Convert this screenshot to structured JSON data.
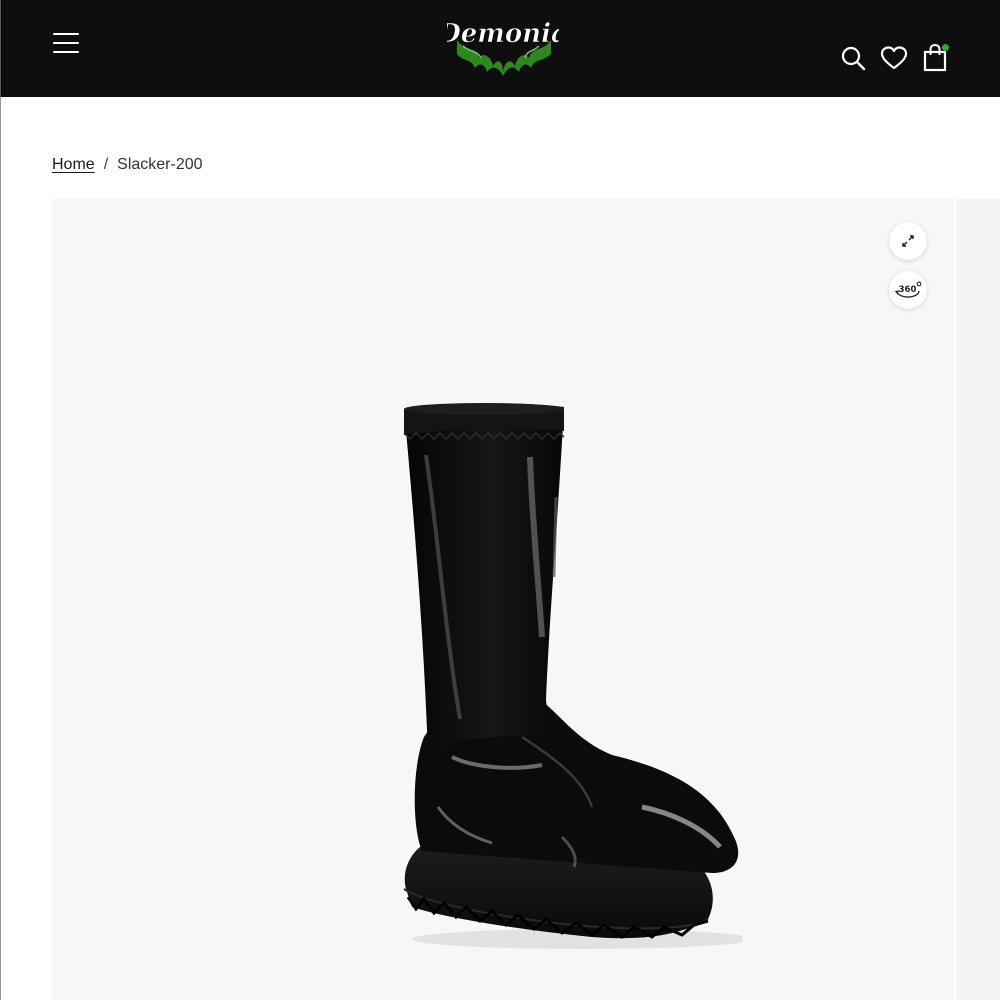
{
  "header": {
    "brand": "Demonia",
    "menu_icon": "hamburger-menu-icon",
    "search_icon": "search-icon",
    "wishlist_icon": "heart-icon",
    "cart_icon": "shopping-bag-icon",
    "cart_indicator_color": "#2fa82b"
  },
  "breadcrumb": {
    "home": "Home",
    "separator": "/",
    "current": "Slacker-200"
  },
  "gallery": {
    "zoom_icon": "expand-icon",
    "rotate_icon": "360-view-icon",
    "rotate_label": "360",
    "product_image": "black-patent-knee-high-platform-boot"
  },
  "colors": {
    "header_bg": "#0e0e0e",
    "logo_green": "#3fae2a",
    "gallery_bg": "#f7f7f7"
  }
}
